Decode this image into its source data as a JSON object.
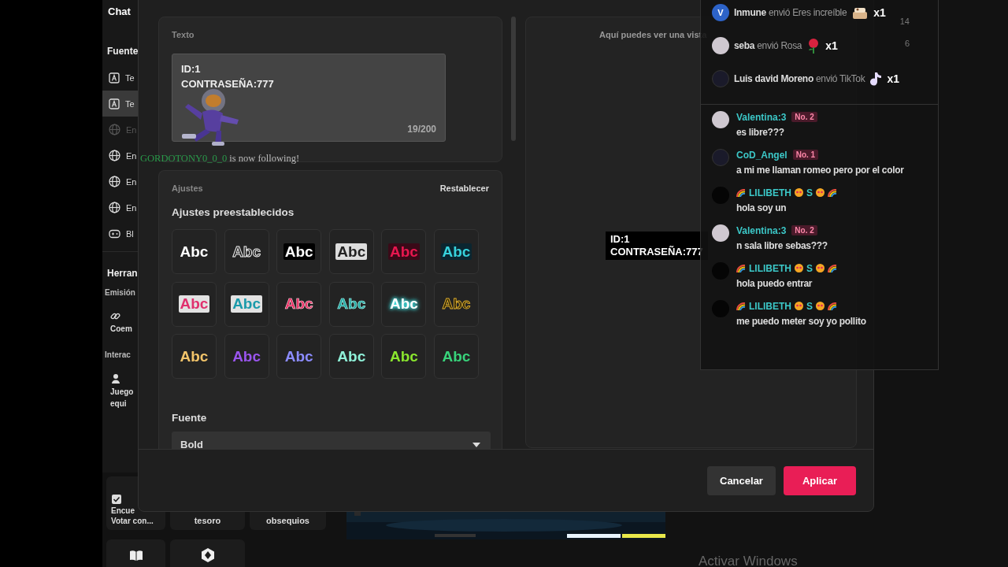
{
  "sidebar": {
    "title": "Chat",
    "section_title": "Fuente",
    "items": [
      {
        "label": "Te",
        "kind": "text",
        "selected": false,
        "disabled": false
      },
      {
        "label": "Te",
        "kind": "text",
        "selected": true,
        "disabled": false
      },
      {
        "label": "En",
        "kind": "globe",
        "selected": false,
        "disabled": true
      },
      {
        "label": "En",
        "kind": "globe",
        "selected": false,
        "disabled": false
      },
      {
        "label": "En",
        "kind": "globe",
        "selected": false,
        "disabled": false
      },
      {
        "label": "En",
        "kind": "globe",
        "selected": false,
        "disabled": false
      },
      {
        "label": "Bl",
        "kind": "game",
        "selected": false,
        "disabled": false
      }
    ],
    "tools_title": "Herran",
    "emission_label": "Emisión",
    "emission_tile": {
      "label": "Coem"
    },
    "interaction_label": "Interac",
    "interaction_tile": {
      "lines": [
        "Juego",
        "equi"
      ]
    }
  },
  "tiles": [
    {
      "lines": [
        "Encue",
        "Votar con..."
      ],
      "kind": "poll"
    },
    {
      "lines": [
        "tesoro"
      ],
      "kind": "plain"
    },
    {
      "lines": [
        "obsequios"
      ],
      "kind": "plain"
    },
    {
      "kind": "book"
    },
    {
      "kind": "hexagon"
    }
  ],
  "dialog": {
    "text_section": {
      "label": "Texto",
      "value": "ID:1\nCONTRASEÑA:777",
      "counter": "19/200"
    },
    "settings": {
      "label": "Ajustes",
      "reset": "Restablecer",
      "presets_title": "Ajustes preestablecidos",
      "presets": [
        {
          "text": "Abc",
          "kind": "plain"
        },
        {
          "text": "Abc",
          "kind": "outline"
        },
        {
          "text": "Abc",
          "kind": "dark-box"
        },
        {
          "text": "Abc",
          "kind": "light-box"
        },
        {
          "text": "Abc",
          "kind": "red-box"
        },
        {
          "text": "Abc",
          "kind": "cyan-box"
        },
        {
          "text": "Abc",
          "kind": "pink-box"
        },
        {
          "text": "Abc",
          "kind": "aqua-box"
        },
        {
          "text": "Abc",
          "kind": "red-outline"
        },
        {
          "text": "Abc",
          "kind": "teal-outline"
        },
        {
          "text": "Abc",
          "kind": "glow"
        },
        {
          "text": "Abc",
          "kind": "gold-outline"
        },
        {
          "text": "Abc",
          "kind": "gold"
        },
        {
          "text": "Abc",
          "kind": "purple"
        },
        {
          "text": "Abc",
          "kind": "violet"
        },
        {
          "text": "Abc",
          "kind": "mint"
        },
        {
          "text": "Abc",
          "kind": "lime"
        },
        {
          "text": "Abc",
          "kind": "green"
        }
      ],
      "font_label": "Fuente",
      "font_value": "Bold"
    },
    "preview": {
      "hint": "Aquí puedes ver una vista",
      "lines": [
        "ID:1",
        "CONTRASEÑA:777"
      ]
    },
    "cancel": "Cancelar",
    "apply": "Aplicar"
  },
  "follow_notice": {
    "user": "GORDOTONY0_0_0",
    "text": "is now following!"
  },
  "chat_overlay": {
    "gifts": [
      {
        "kind": "cake",
        "avatar_letter": "V",
        "user": "Inmune",
        "action": "envió Eres increíble",
        "count": "x1",
        "side_number": "14"
      },
      {
        "kind": "rose",
        "user": "seba",
        "action": "envió Rosa",
        "count": "x1",
        "side_number": "6"
      },
      {
        "kind": "note",
        "user": "Luis david Moreno",
        "action": "envió TikTok",
        "count": "x1"
      }
    ],
    "messages": [
      {
        "user": "Valentina:3",
        "decorated": false,
        "badge": "No. 2",
        "text": "es libre???"
      },
      {
        "user": "CoD_Angel",
        "decorated": false,
        "badge": "No. 1",
        "text": "a mi me llaman romeo pero por el color"
      },
      {
        "user": "LILIBETH",
        "decorated": true,
        "tag": "S",
        "text": "hola soy un"
      },
      {
        "user": "Valentina:3",
        "decorated": false,
        "badge": "No. 2",
        "text": "n sala libre sebas???"
      },
      {
        "user": "LILIBETH",
        "decorated": true,
        "tag": "S",
        "text": "hola puedo entrar"
      },
      {
        "user": "LILIBETH",
        "decorated": true,
        "tag": "S",
        "text": "me puedo meter soy yo pollito"
      }
    ]
  },
  "os_notice": "Activar Windows"
}
